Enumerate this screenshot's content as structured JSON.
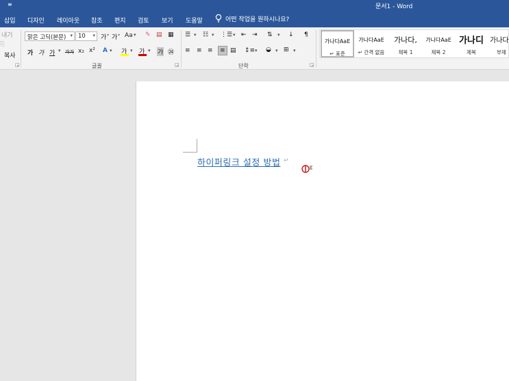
{
  "titlebar": {
    "quick_access": "≡",
    "title": "문서1  -  Word"
  },
  "tabs": [
    {
      "label": "삽입"
    },
    {
      "label": "디자인"
    },
    {
      "label": "레이아웃"
    },
    {
      "label": "참조"
    },
    {
      "label": "편지"
    },
    {
      "label": "검토"
    },
    {
      "label": "보기"
    },
    {
      "label": "도움말"
    }
  ],
  "tell_me": {
    "label": "어떤 작업을 원하시나요?"
  },
  "clipboard": {
    "cut": "내기",
    "copy": "복사"
  },
  "font": {
    "family": "맑은 고딕(본문)",
    "size": "10",
    "grow": "가˄",
    "shrink": "가˅",
    "case": "Aa",
    "bold": "가",
    "italic": "가",
    "underline": "가",
    "strike": "가가",
    "subscript": "x₂",
    "superscript": "x²",
    "highlight_letter": "가",
    "color_letter": "가",
    "char_shade": "가",
    "enclose": "㉔",
    "label": "글꼴"
  },
  "paragraph": {
    "label": "단락"
  },
  "styles": [
    {
      "preview": "가나다AaE",
      "name": "↵ 표준"
    },
    {
      "preview": "가나다AaE",
      "name": "↵ 간격 없음"
    },
    {
      "preview": "가나다,",
      "name": "제목 1"
    },
    {
      "preview": "가나다AaE",
      "name": "제목 2"
    },
    {
      "preview": "가나디",
      "name": "제목"
    },
    {
      "preview": "가나다",
      "name": "부제"
    }
  ],
  "document": {
    "hyperlink_text": "하이퍼링크 설정 방법",
    "paragraph_mark": "↵"
  },
  "colors": {
    "accent": "#2b579a",
    "hyperlink": "#2e6db5",
    "highlight": "#ffff00",
    "font_color": "#d00000"
  }
}
